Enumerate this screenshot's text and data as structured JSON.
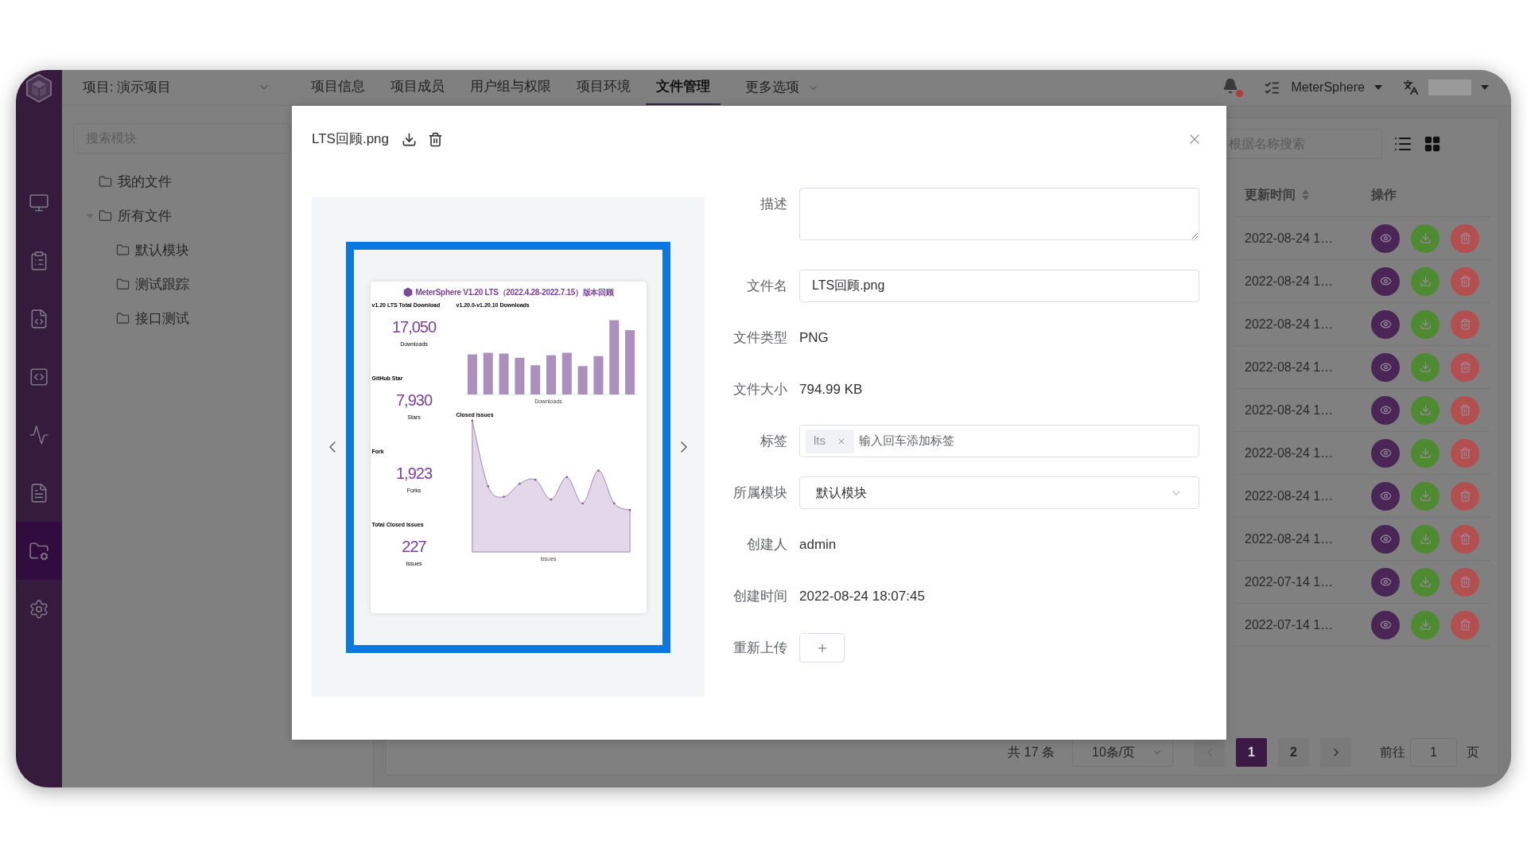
{
  "sidebar": {
    "items": [
      {
        "kind": "workstation",
        "selected": false
      },
      {
        "kind": "track",
        "selected": false
      },
      {
        "kind": "api",
        "selected": false
      },
      {
        "kind": "ui",
        "selected": false
      },
      {
        "kind": "performance",
        "selected": false
      },
      {
        "kind": "report",
        "selected": false
      },
      {
        "kind": "files",
        "selected": true
      },
      {
        "kind": "settings",
        "selected": false
      }
    ]
  },
  "topbar": {
    "project": "项目: 演示项目",
    "tabs": [
      {
        "label": "项目信息",
        "selected": false
      },
      {
        "label": "项目成员",
        "selected": false
      },
      {
        "label": "用户组与权限",
        "selected": false
      },
      {
        "label": "项目环境",
        "selected": false
      },
      {
        "label": "文件管理",
        "selected": true
      }
    ],
    "more": "更多选项",
    "notifications": {
      "unread": true
    },
    "workspace": "MeterSphere"
  },
  "tree": {
    "search_placeholder": "搜索模块",
    "items": [
      {
        "label": "我的文件"
      },
      {
        "label": "所有文件",
        "expanded": true,
        "children": [
          {
            "label": "默认模块"
          },
          {
            "label": "测试跟踪"
          },
          {
            "label": "接口测试"
          }
        ]
      }
    ]
  },
  "files": {
    "search_placeholder": "根据名称搜索",
    "columns": [
      "更新时间",
      "操作"
    ],
    "rows": [
      {
        "updated": "2022-08-24 1…"
      },
      {
        "updated": "2022-08-24 1…"
      },
      {
        "updated": "2022-08-24 1…"
      },
      {
        "updated": "2022-08-24 1…"
      },
      {
        "updated": "2022-08-24 1…"
      },
      {
        "updated": "2022-08-24 1…"
      },
      {
        "updated": "2022-08-24 1…"
      },
      {
        "updated": "2022-08-24 1…"
      },
      {
        "updated": "2022-07-14 1…"
      },
      {
        "updated": "2022-07-14 1…"
      }
    ],
    "pagination": {
      "total": "共 17 条",
      "page_size": "10条/页",
      "pages": [
        {
          "label": "1",
          "selected": true
        },
        {
          "label": "2",
          "selected": false
        }
      ],
      "goto_label": "前往",
      "goto_value": "1",
      "goto_suffix": "页"
    }
  },
  "dialog": {
    "title": "LTS回顾.png",
    "image": {
      "title": "MeterSphere V1.20 LTS（2022.4.28-2022.7.15）版本回顾",
      "stats": [
        {
          "label": "v1.20 LTS Total Download",
          "value": "17,050",
          "unit": "Downloads"
        },
        {
          "label": "GitHub Star",
          "value": "7,930",
          "unit": "Stars"
        },
        {
          "label": "Fork",
          "value": "1,923",
          "unit": "Forks"
        },
        {
          "label": "Total Closed Issues",
          "value": "227",
          "unit": "Issues"
        }
      ],
      "charts": [
        {
          "kind": "bar",
          "title": "v1.20.0-v1.20.10 Downloads",
          "legend": "Downloads"
        },
        {
          "kind": "area",
          "title": "Closed Issues",
          "legend": "Issues"
        }
      ]
    },
    "fields": [
      {
        "kind": "textarea",
        "label": "描述"
      },
      {
        "kind": "input",
        "label": "文件名",
        "value": "LTS回顾.png"
      },
      {
        "kind": "text",
        "label": "文件类型",
        "value": "PNG"
      },
      {
        "kind": "text",
        "label": "文件大小",
        "value": "794.99 KB"
      },
      {
        "kind": "tags",
        "label": "标签",
        "tags": [
          "lts"
        ],
        "placeholder": "输入回车添加标签"
      },
      {
        "kind": "select",
        "label": "所属模块",
        "value": "默认模块"
      },
      {
        "kind": "text",
        "label": "创建人",
        "value": "admin"
      },
      {
        "kind": "text",
        "label": "创建时间",
        "value": "2022-08-24 18:07:45"
      },
      {
        "kind": "upload",
        "label": "重新上传"
      }
    ]
  }
}
